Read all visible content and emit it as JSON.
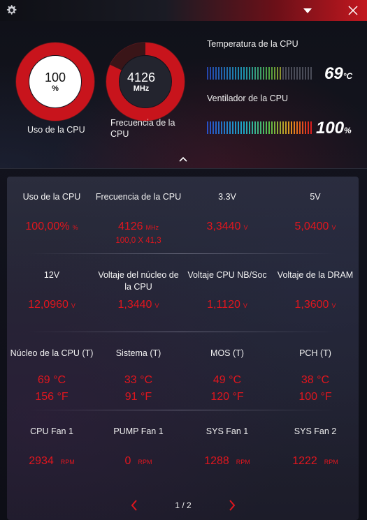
{
  "header": {
    "cpu_usage": {
      "value": "100",
      "unit": "%",
      "caption": "Uso de la CPU",
      "percent": 100
    },
    "cpu_freq": {
      "value": "4126",
      "unit": "MHz",
      "caption": "Frecuencia de la CPU",
      "percent": 82
    },
    "cpu_temp": {
      "title": "Temperatura de la CPU",
      "value": "69",
      "unit": "°C",
      "level": 0.69
    },
    "cpu_fan": {
      "title": "Ventilador de la CPU",
      "value": "100",
      "unit": "%",
      "level": 1.0
    }
  },
  "colors": {
    "accent": "#e0161e",
    "ring": "#c8141c",
    "ring_track": "#3a1518"
  },
  "rows": [
    [
      {
        "label": "Uso de la CPU",
        "value": "100,00%",
        "unit": "%",
        "sub": ""
      },
      {
        "label": "Frecuencia de la CPU",
        "value": "4126",
        "unit": "MHz",
        "sub": "100,0 X 41,3"
      },
      {
        "label": "3.3V",
        "value": "3,3440",
        "unit": "V",
        "sub": ""
      },
      {
        "label": "5V",
        "value": "5,0400",
        "unit": "V",
        "sub": ""
      }
    ],
    [
      {
        "label": "12V",
        "value": "12,0960",
        "unit": "V"
      },
      {
        "label": "Voltaje del núcleo de la CPU",
        "value": "1,3440",
        "unit": "V"
      },
      {
        "label": "Voltaje CPU NB/Soc",
        "value": "1,1120",
        "unit": "V"
      },
      {
        "label": "Voltaje de la DRAM",
        "value": "1,3600",
        "unit": "V"
      }
    ],
    [
      {
        "label": "Núcleo de la CPU (T)",
        "value": "69 °C",
        "value2": "156 °F"
      },
      {
        "label": "Sistema (T)",
        "value": "33 °C",
        "value2": "91 °F"
      },
      {
        "label": "MOS (T)",
        "value": "49 °C",
        "value2": "120 °F"
      },
      {
        "label": "PCH (T)",
        "value": "38 °C",
        "value2": "100 °F"
      }
    ],
    [
      {
        "label": "CPU Fan 1",
        "value": "2934",
        "unit": "RPM"
      },
      {
        "label": "PUMP Fan 1",
        "value": "0",
        "unit": "RPM"
      },
      {
        "label": "SYS Fan 1",
        "value": "1288",
        "unit": "RPM"
      },
      {
        "label": "SYS Fan 2",
        "value": "1222",
        "unit": "RPM"
      }
    ]
  ],
  "pager": {
    "text": "1 / 2"
  },
  "icons": {
    "settings": "gear-icon",
    "dropdown": "triangle-down-icon",
    "close": "close-icon",
    "collapse": "chevron-up-icon",
    "prev": "chevron-left-icon",
    "next": "chevron-right-icon"
  }
}
